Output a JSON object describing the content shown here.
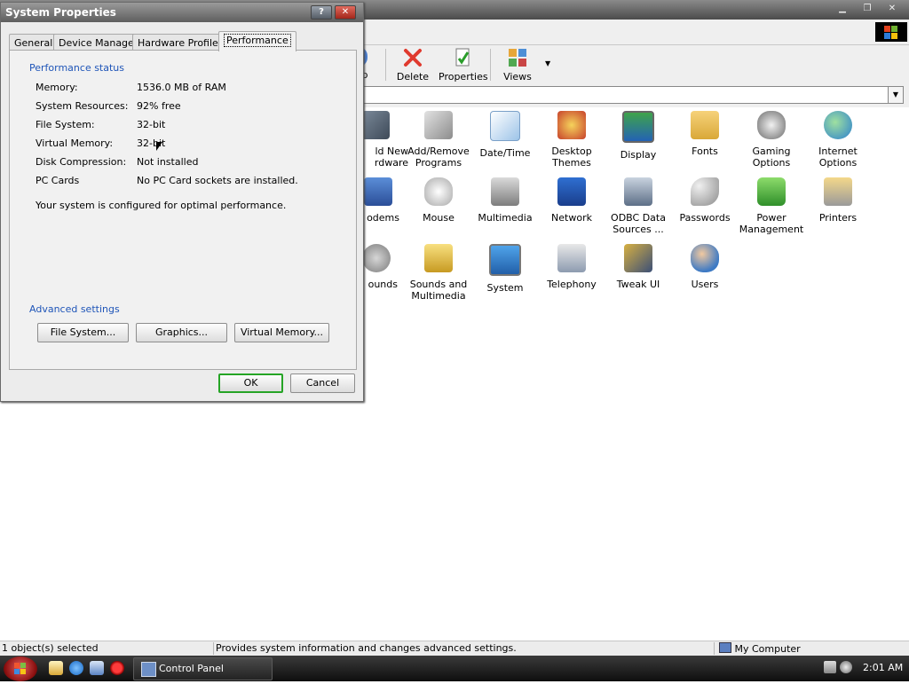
{
  "background_window": {
    "toolbar": {
      "partial_label": "p",
      "delete_label": "Delete",
      "properties_label": "Properties",
      "views_label": "Views"
    },
    "icons": [
      {
        "name": "ld New\nrdware",
        "icon": "add-hardware-icon"
      },
      {
        "name": "Add/Remove\nPrograms",
        "icon": "add-remove-programs-icon"
      },
      {
        "name": "Date/Time",
        "icon": "calendar-clock-icon"
      },
      {
        "name": "Desktop\nThemes",
        "icon": "desktop-themes-icon"
      },
      {
        "name": "Display",
        "icon": "monitor-icon"
      },
      {
        "name": "Fonts",
        "icon": "fonts-folder-icon"
      },
      {
        "name": "Gaming\nOptions",
        "icon": "gamepad-icon"
      },
      {
        "name": "Internet\nOptions",
        "icon": "globe-icon"
      },
      {
        "name": "odems",
        "icon": "modem-icon"
      },
      {
        "name": "Mouse",
        "icon": "mouse-icon"
      },
      {
        "name": "Multimedia",
        "icon": "speaker-icon"
      },
      {
        "name": "Network",
        "icon": "network-icon"
      },
      {
        "name": "ODBC Data\nSources ...",
        "icon": "odbc-icon"
      },
      {
        "name": "Passwords",
        "icon": "key-icon"
      },
      {
        "name": "Power\nManagement",
        "icon": "battery-icon"
      },
      {
        "name": "Printers",
        "icon": "printer-icon"
      },
      {
        "name": "ounds",
        "icon": "sounds-icon"
      },
      {
        "name": "Sounds and\nMultimedia",
        "icon": "sound-speaker-icon"
      },
      {
        "name": "System",
        "icon": "system-computer-icon"
      },
      {
        "name": "Telephony",
        "icon": "telephone-icon"
      },
      {
        "name": "Tweak UI",
        "icon": "tweak-ui-icon"
      },
      {
        "name": "Users",
        "icon": "users-icon"
      }
    ]
  },
  "status_bar": {
    "selected": "1 object(s) selected",
    "description": "Provides system information and changes advanced settings.",
    "location": "My Computer"
  },
  "taskbar": {
    "task_label": "Control Panel",
    "clock": "2:01 AM"
  },
  "dialog": {
    "title": "System Properties",
    "help_label": "?",
    "close_label": "✕",
    "tabs": [
      "General",
      "Device Manager",
      "Hardware Profiles",
      "Performance"
    ],
    "active_tab": "Performance",
    "performance_status_heading": "Performance status",
    "rows": [
      {
        "label": "Memory:",
        "value": "1536.0 MB of RAM"
      },
      {
        "label": "System Resources:",
        "value": "92% free"
      },
      {
        "label": "File System:",
        "value": "32-bit"
      },
      {
        "label": "Virtual Memory:",
        "value": "32-bit"
      },
      {
        "label": "Disk Compression:",
        "value": "Not installed"
      },
      {
        "label": "PC Cards",
        "value": "No PC Card sockets are installed."
      }
    ],
    "summary": "Your system is configured for optimal performance.",
    "advanced_heading": "Advanced settings",
    "buttons": {
      "file_system": "File System...",
      "graphics": "Graphics...",
      "virtual_memory": "Virtual Memory..."
    },
    "ok_label": "OK",
    "cancel_label": "Cancel"
  }
}
